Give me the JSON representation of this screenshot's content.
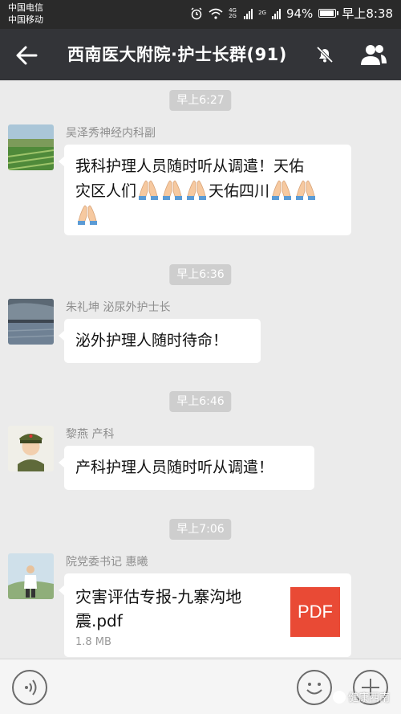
{
  "status_bar": {
    "carrier_1": "中国电信",
    "carrier_2": "中国移动",
    "net_1": "4G 2G",
    "net_2": "2G",
    "battery": "94%",
    "time": "早上8:38"
  },
  "header": {
    "title": "西南医大附院·护士长群(91)",
    "icons": [
      "back-arrow-icon",
      "mute-bell-icon",
      "group-members-icon"
    ]
  },
  "messages": [
    {
      "time": "早上6:27",
      "sender": "吴泽秀神经内科副",
      "line1": "我科护理人员随时听从调遣！天佑",
      "line2_a": "灾区人们",
      "line2_b": "天佑四川",
      "emoji": "folded-hands-emoji"
    },
    {
      "time": "早上6:36",
      "sender": "朱礼坤 泌尿外护士长",
      "text": "泌外护理人随时待命！"
    },
    {
      "time": "早上6:46",
      "sender": "黎燕 产科",
      "text": "产科护理人员随时听从调遣！"
    },
    {
      "time": "早上7:06",
      "sender": "院党委书记 惠曦",
      "file_name": "灾害评估专报-九寨沟地震.pdf",
      "file_size": "1.8 MB",
      "file_type": "PDF"
    }
  ],
  "input_bar": {
    "icons": [
      "voice-icon",
      "emoji-icon",
      "plus-icon"
    ]
  },
  "watermark": "健康西南",
  "colors": {
    "header_bg": "#333438",
    "chat_bg": "#ebebeb",
    "bubble_bg": "#ffffff",
    "pdf_red": "#e94a35"
  }
}
